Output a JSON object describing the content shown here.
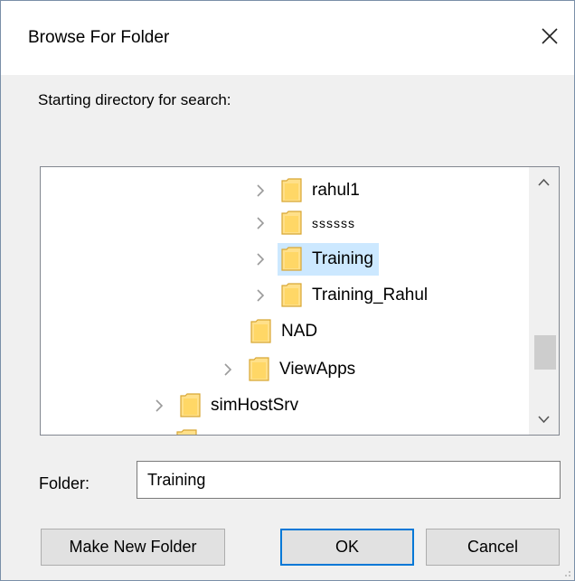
{
  "window": {
    "title": "Browse For Folder"
  },
  "description": "Starting directory for search:",
  "tree": {
    "nodes": [
      {
        "label": "rahul1",
        "has_chevron": true,
        "selected": false
      },
      {
        "label": "ssssss",
        "has_chevron": true,
        "selected": false
      },
      {
        "label": "Training",
        "has_chevron": true,
        "selected": true
      },
      {
        "label": "Training_Rahul",
        "has_chevron": true,
        "selected": false
      },
      {
        "label": "NAD",
        "has_chevron": false,
        "selected": false
      },
      {
        "label": "ViewApps",
        "has_chevron": true,
        "selected": false
      },
      {
        "label": "simHostSrv",
        "has_chevron": true,
        "selected": false
      }
    ]
  },
  "folder_field": {
    "label": "Folder:",
    "value": "Training"
  },
  "buttons": {
    "make_new_folder": "Make New Folder",
    "ok": "OK",
    "cancel": "Cancel"
  },
  "icons": {
    "close": "close-icon",
    "chevron": "chevron-right-icon",
    "folder": "folder-icon",
    "scroll_up": "chevron-up-icon",
    "scroll_down": "chevron-down-icon"
  },
  "colors": {
    "selection": "#cce8ff",
    "focus_border": "#0078d7",
    "folder_fill": "#ffe08a",
    "folder_stroke": "#d8a634"
  }
}
